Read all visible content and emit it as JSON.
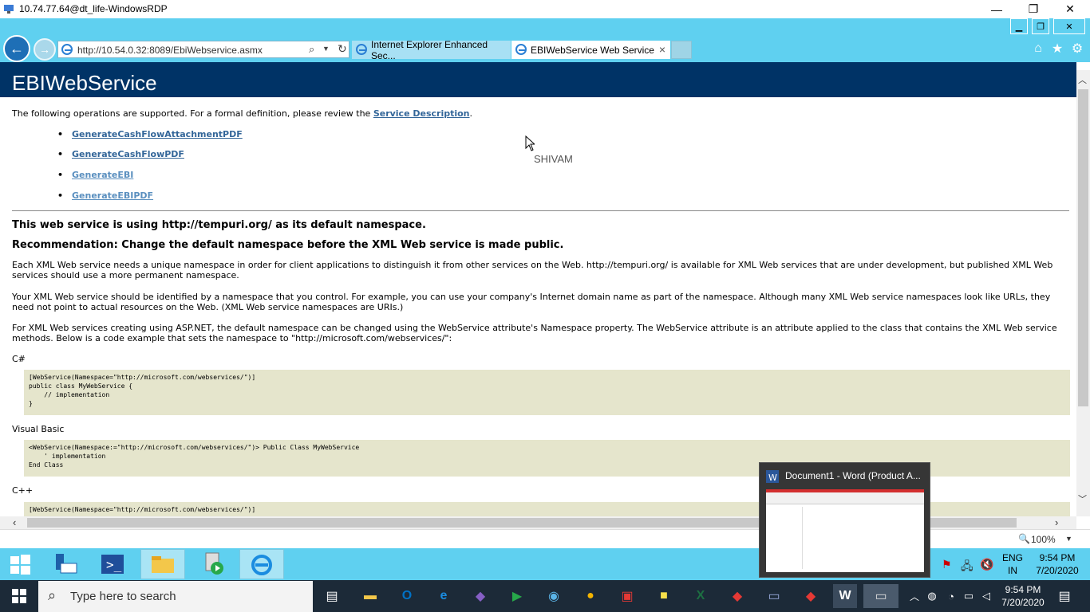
{
  "rdp": {
    "title": "10.74.77.64@dt_life-WindowsRDP",
    "minimize": "—",
    "restore": "❐",
    "close": "✕"
  },
  "browser": {
    "url": "http://10.54.0.32:8089/EbiWebservice.asmx",
    "tabs": [
      {
        "label": "Internet Explorer Enhanced Sec..."
      },
      {
        "label": "EBIWebService Web Service",
        "close": "×"
      }
    ],
    "zoom": "100%"
  },
  "page": {
    "title": "EBIWebService",
    "intro_prefix": "The following operations are supported. For a formal definition, please review the ",
    "intro_link": "Service Description",
    "intro_suffix": ".",
    "operations": [
      "GenerateCashFlowAttachmentPDF",
      "GenerateCashFlowPDF",
      "GenerateEBI",
      "GenerateEBIPDF"
    ],
    "ns_heading": "This web service is using http://tempuri.org/ as its default namespace.",
    "rec_heading": "Recommendation: Change the default namespace before the XML Web service is made public.",
    "para1": "Each XML Web service needs a unique namespace in order for client applications to distinguish it from other services on the Web. http://tempuri.org/ is available for XML Web services that are under development, but published XML Web services should use a more permanent namespace.",
    "para2": "Your XML Web service should be identified by a namespace that you control. For example, you can use your company's Internet domain name as part of the namespace. Although many XML Web service namespaces look like URLs, they need not point to actual resources on the Web. (XML Web service namespaces are URIs.)",
    "para3": "For XML Web services creating using ASP.NET, the default namespace can be changed using the WebService attribute's Namespace property. The WebService attribute is an attribute applied to the class that contains the XML Web service methods. Below is a code example that sets the namespace to \"http://microsoft.com/webservices/\":",
    "lang_cs": "C#",
    "code_cs": "[WebService(Namespace=\"http://microsoft.com/webservices/\")]\npublic class MyWebService {\n    // implementation\n}",
    "lang_vb": "Visual Basic",
    "code_vb": "<WebService(Namespace:=\"http://microsoft.com/webservices/\")> Public Class MyWebService\n    ' implementation\nEnd Class",
    "lang_cpp": "C++",
    "code_cpp": "[WebService(Namespace=\"http://microsoft.com/webservices/\")]"
  },
  "overlay_text": "SHIVAM",
  "inner_taskbar": {
    "lang1": "ENG",
    "lang2": "IN",
    "time": "9:54 PM",
    "date": "7/20/2020"
  },
  "thumbnail": {
    "title": "Document1 - Word (Product A..."
  },
  "taskbar": {
    "search_placeholder": "Type here to search",
    "time": "9:54 PM",
    "date": "7/20/2020"
  }
}
